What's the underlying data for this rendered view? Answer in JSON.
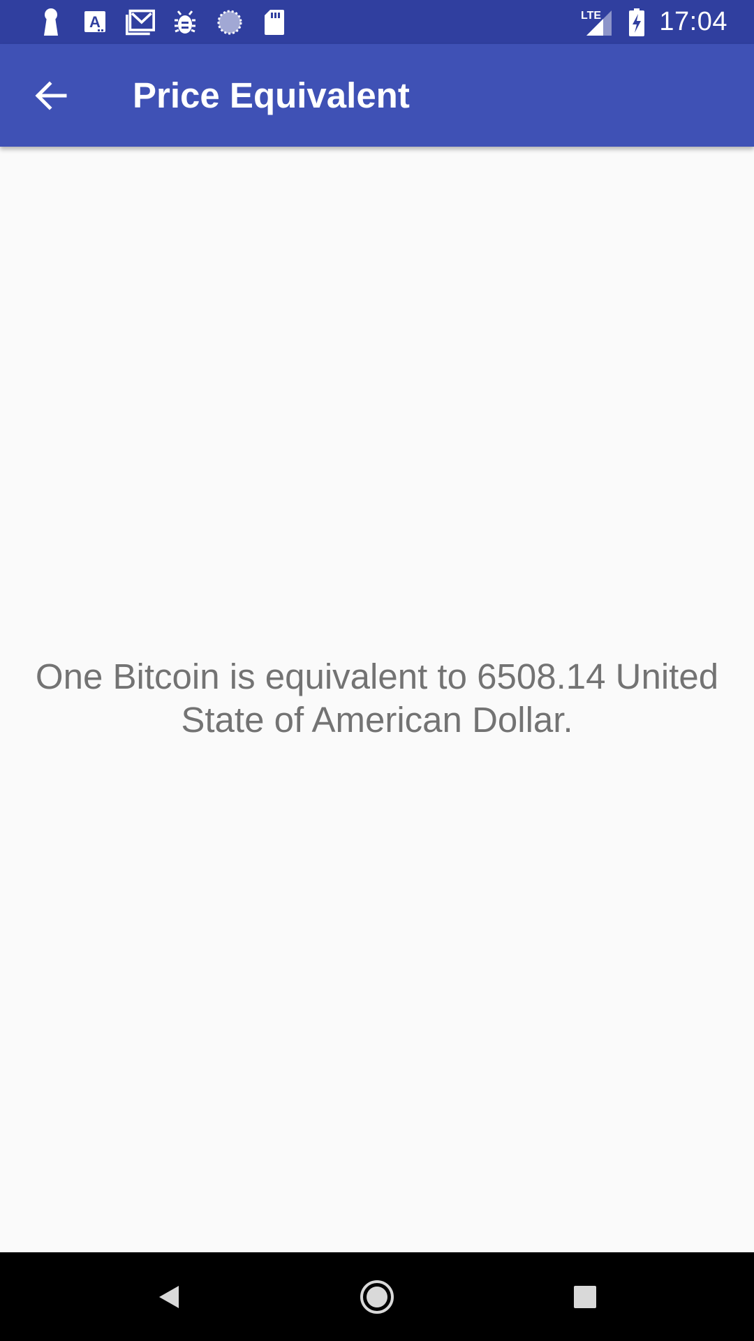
{
  "status_bar": {
    "time": "17:04",
    "network_label": "LTE",
    "left_icons": [
      "keyhole-icon",
      "font-a-icon",
      "mail-icon",
      "bug-icon",
      "sync-circle-icon",
      "sd-card-icon"
    ],
    "right_icons": [
      "lte-signal-icon",
      "battery-charging-icon"
    ]
  },
  "app_bar": {
    "title": "Price Equivalent",
    "back_icon": "arrow-back-icon"
  },
  "main": {
    "equivalent_text": "One Bitcoin is equivalent to 6508.14 United State of American Dollar."
  },
  "nav_bar": {
    "icons": [
      "back-triangle-icon",
      "home-circle-icon",
      "recents-square-icon"
    ]
  },
  "colors": {
    "status_bar": "#303f9f",
    "app_bar": "#3f51b5",
    "background": "#fafafa",
    "body_text": "#737373",
    "nav_bar": "#000000"
  }
}
